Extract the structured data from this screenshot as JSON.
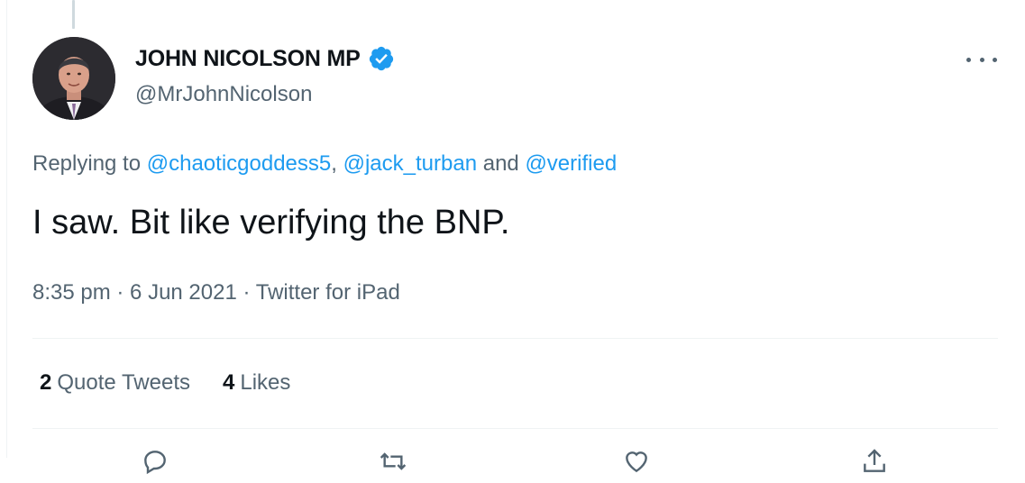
{
  "tweet": {
    "author_name": "JOHN NICOLSON MP",
    "author_handle": "@MrJohnNicolson",
    "replying_prefix": "Replying to ",
    "replying_to": [
      "@chaoticgoddess5",
      "@jack_turban",
      "@verified"
    ],
    "replying_sep1": ", ",
    "replying_sep2": " and ",
    "text": "I saw. Bit like verifying the BNP.",
    "time": "8:35 pm",
    "date": "6 Jun 2021",
    "source": "Twitter for iPad",
    "dot": " · "
  },
  "stats": {
    "quote_count": "2",
    "quote_label": "Quote Tweets",
    "likes_count": "4",
    "likes_label": "Likes"
  },
  "icons": {
    "verified": "verified-badge-icon",
    "more": "more-icon",
    "reply": "reply-icon",
    "retweet": "retweet-icon",
    "like": "heart-icon",
    "share": "share-icon"
  },
  "colors": {
    "accent": "#1d9bf0",
    "text": "#0f1419",
    "secondary": "#536471",
    "divider": "#eff3f4"
  }
}
